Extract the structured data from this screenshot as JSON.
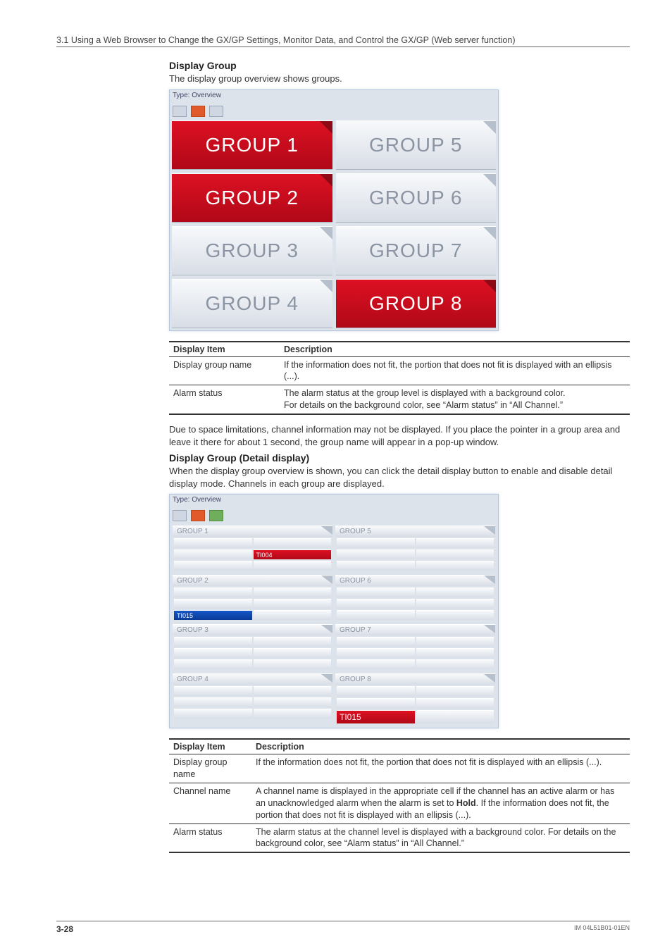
{
  "header": {
    "link_text": "3.1  Using a Web Browser to Change the GX/GP Settings, Monitor Data, and Control the GX/GP (Web server function)"
  },
  "section1": {
    "title": "Display Group",
    "intro": "The display group overview shows groups.",
    "shot_label": "Type: Overview",
    "tiles": [
      {
        "label": "GROUP 1",
        "alarm": true
      },
      {
        "label": "GROUP 5",
        "alarm": false
      },
      {
        "label": "GROUP 2",
        "alarm": true
      },
      {
        "label": "GROUP 6",
        "alarm": false
      },
      {
        "label": "GROUP 3",
        "alarm": false
      },
      {
        "label": "GROUP 7",
        "alarm": false
      },
      {
        "label": "GROUP 4",
        "alarm": false
      },
      {
        "label": "GROUP 8",
        "alarm": true
      }
    ],
    "table": {
      "headers": [
        "Display Item",
        "Description"
      ],
      "rows": [
        [
          "Display group name",
          "If the information does not fit, the portion that does not fit is displayed with an ellipsis (...)."
        ],
        [
          "Alarm status",
          "The alarm status at the group level is displayed with a background color.\nFor details on the background color, see “Alarm status” in “All Channel.”"
        ]
      ]
    },
    "note": "Due to space limitations, channel information may not be displayed. If you place the pointer in a group area and leave it there for about 1 second, the group name will appear in a pop-up window."
  },
  "section2": {
    "title": "Display Group (Detail display)",
    "intro": "When the display group overview is shown, you can click the detail display button to enable and disable detail display mode. Channels in each group are displayed.",
    "shot_label": "Type: Overview",
    "group_labels": [
      "GROUP 1",
      "GROUP 2",
      "GROUP 3",
      "GROUP 4",
      "GROUP 5",
      "GROUP 6",
      "GROUP 7",
      "GROUP 8"
    ],
    "ch_labels": {
      "ti004": "TI004",
      "ti015_small": "TI015",
      "ti015_big": "TI015"
    },
    "table": {
      "headers": [
        "Display Item",
        "Description"
      ],
      "rows": [
        [
          "Display group name",
          "If the information does not fit, the portion that does not fit is displayed with an ellipsis (...)."
        ],
        [
          "Channel name",
          "A channel name is displayed in the appropriate cell if the channel has an active alarm or has an unacknowledged alarm when the alarm is set to Hold. If the information does not fit, the portion that does not fit is displayed with an ellipsis (...)."
        ],
        [
          "Alarm status",
          "The alarm status at the channel level is displayed with a background color. For details on the background color, see “Alarm status” in “All Channel.”"
        ]
      ]
    },
    "hold_word": "Hold"
  },
  "footer": {
    "page": "3-28",
    "doc": "IM 04L51B01-01EN"
  }
}
